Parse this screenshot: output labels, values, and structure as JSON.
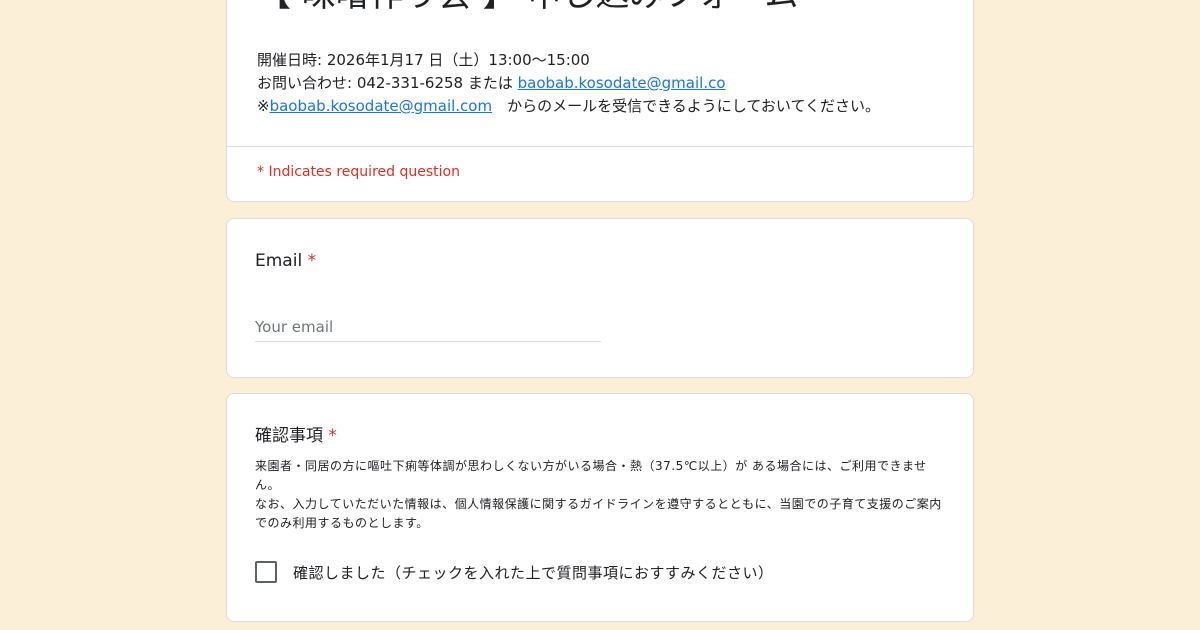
{
  "colors": {
    "page_background": "#fbf0d7",
    "card_background": "#ffffff",
    "required": "#d93025",
    "link": "#1a73e8"
  },
  "header": {
    "title": "【 味噌作り会 】 申し込みフォーム",
    "date_line": "開催日時: 2026年1月17 日（土）13:00～15:00",
    "contact_prefix": "お問い合わせ: 042-331-6258 または ",
    "contact_email": "baobab.kosodate@gmail.co",
    "note_prefix": "※",
    "note_email": "baobab.kosodate@gmail.com",
    "note_suffix": "　からのメールを受信できるようにしておいてください。",
    "required_note": "* Indicates required question"
  },
  "email_question": {
    "title": "Email",
    "required_mark": "*",
    "placeholder": "Your email",
    "value": ""
  },
  "confirm_question": {
    "title": "確認事項",
    "required_mark": "*",
    "description_1": "来園者・同居の方に嘔吐下痢等体調が思わしくない方がいる場合・熱（37.5℃以上）が ある場合には、ご利用できません。",
    "description_2": "なお、入力していただいた情報は、個人情報保護に関するガイドラインを遵守するとともに、当園での子育て支援のご案内でのみ利用するものとします。",
    "checkbox_label": "確認しました（チェックを入れた上で質問事項におすすみください）",
    "checkbox_checked": false
  }
}
